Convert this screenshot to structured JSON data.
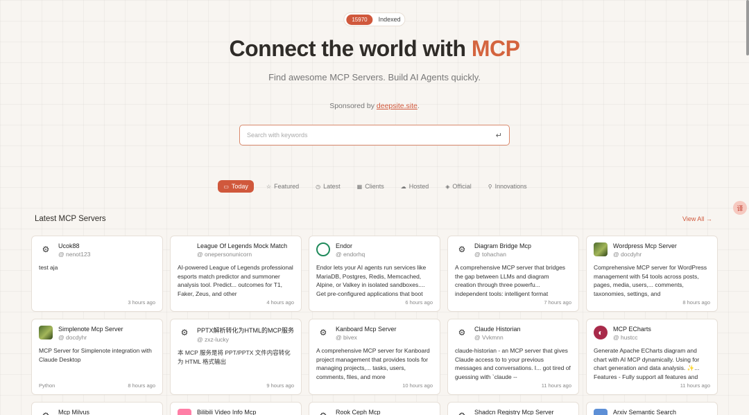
{
  "badge": {
    "count": "15970",
    "label": "Indexed"
  },
  "hero": {
    "title_prefix": "Connect the world with ",
    "title_accent": "MCP",
    "subtitle": "Find awesome MCP Servers. Build AI Agents quickly.",
    "sponsor_prefix": "Sponsored by ",
    "sponsor_link": "deepsite.site",
    "sponsor_suffix": "."
  },
  "search": {
    "placeholder": "Search with keywords",
    "enter_icon": "↵"
  },
  "tabs": [
    {
      "label": "Today",
      "icon": "calendar-icon",
      "glyph": "▭",
      "active": true
    },
    {
      "label": "Featured",
      "icon": "star-icon",
      "glyph": "☆",
      "active": false
    },
    {
      "label": "Latest",
      "icon": "clock-icon",
      "glyph": "◷",
      "active": false
    },
    {
      "label": "Clients",
      "icon": "grid-icon",
      "glyph": "▦",
      "active": false
    },
    {
      "label": "Hosted",
      "icon": "cloud-icon",
      "glyph": "☁",
      "active": false
    },
    {
      "label": "Official",
      "icon": "badge-icon",
      "glyph": "◈",
      "active": false
    },
    {
      "label": "Innovations",
      "icon": "lightbulb-icon",
      "glyph": "⚲",
      "active": false
    }
  ],
  "section": {
    "title": "Latest MCP Servers",
    "view_all": "View All →"
  },
  "cards": [
    {
      "name": "Ucok88",
      "author": "@ nenot123",
      "desc": "test aja",
      "tag": "",
      "time": "3 hours ago",
      "avatar": "plain",
      "glyph": "⚙"
    },
    {
      "name": "League Of Legends Mock Match",
      "author": "@ onepersonunicorn",
      "desc": "AI-powered League of Legends professional esports match predictor and summoner analysis tool. Predict... outcomes for T1, Faker, Zeus, and other",
      "tag": "",
      "time": "4 hours ago",
      "avatar": "plain",
      "glyph": ""
    },
    {
      "name": "Endor",
      "author": "@ endorhq",
      "desc": "Endor lets your AI agents run services like MariaDB, Postgres, Redis, Memcached, Alpine, or Valkey in isolated sandboxes.... Get pre-configured applications that boot",
      "tag": "",
      "time": "6 hours ago",
      "avatar": "endor",
      "glyph": ""
    },
    {
      "name": "Diagram Bridge Mcp",
      "author": "@ tohachan",
      "desc": "A comprehensive MCP server that bridges the gap between LLMs and diagram creation through three powerfu... independent tools: intelligent format",
      "tag": "",
      "time": "7 hours ago",
      "avatar": "plain",
      "glyph": "⚙"
    },
    {
      "name": "Wordpress Mcp Server",
      "author": "@ docdyhr",
      "desc": "Comprehensive MCP server for WordPress management with 54 tools across posts, pages, media, users,... comments, taxonomies, settings, and",
      "tag": "",
      "time": "8 hours ago",
      "avatar": "photo",
      "glyph": ""
    },
    {
      "name": "Simplenote Mcp Server",
      "author": "@ docdyhr",
      "desc": "MCP Server for Simplenote integration with Claude Desktop",
      "tag": "Python",
      "time": "8 hours ago",
      "avatar": "photo",
      "glyph": ""
    },
    {
      "name": "PPTX解析转化为HTML的MCP服务",
      "author": "@ zxz-lucky",
      "desc": "本 MCP 服务是将 PPT/PPTX 文件内容转化为 HTML 格式输出",
      "tag": "",
      "time": "9 hours ago",
      "avatar": "plain",
      "glyph": "⚙"
    },
    {
      "name": "Kanboard Mcp Server",
      "author": "@ bivex",
      "desc": "A comprehensive MCP server for Kanboard project management that provides tools for managing projects,... tasks, users, comments, files, and more",
      "tag": "",
      "time": "10 hours ago",
      "avatar": "plain",
      "glyph": "⚙"
    },
    {
      "name": "Claude Historian",
      "author": "@ Vvkmnn",
      "desc": "claude-historian - an MCP server that gives Claude access to to your previous messages and conversations. I... got tired of guessing with `claude --",
      "tag": "",
      "time": "11 hours ago",
      "avatar": "plain",
      "glyph": "⚙"
    },
    {
      "name": "MCP ECharts",
      "author": "@ hustcc",
      "desc": "Generate Apache ECharts diagram and chart with AI MCP dynamically. Using for chart generation and data analysis. ✨... Features - Fully support all features and",
      "tag": "",
      "time": "11 hours ago",
      "avatar": "echarts",
      "glyph": "◐"
    },
    {
      "name": "Mcp Milvus",
      "author": "",
      "desc": "",
      "tag": "",
      "time": "",
      "avatar": "plain",
      "glyph": "⚙"
    },
    {
      "name": "Bilibili Video Info Mcp",
      "author": "",
      "desc": "",
      "tag": "",
      "time": "",
      "avatar": "pink",
      "glyph": ""
    },
    {
      "name": "Rook Ceph Mcp",
      "author": "",
      "desc": "",
      "tag": "",
      "time": "",
      "avatar": "plain",
      "glyph": "⚙"
    },
    {
      "name": "Shadcn Registry Mcp Server",
      "author": "",
      "desc": "",
      "tag": "",
      "time": "",
      "avatar": "plain",
      "glyph": "⚙"
    },
    {
      "name": "Arxiv Semantic Search",
      "author": "",
      "desc": "",
      "tag": "",
      "time": "",
      "avatar": "blue",
      "glyph": ""
    }
  ],
  "floating_widget": {
    "glyph": "译"
  }
}
